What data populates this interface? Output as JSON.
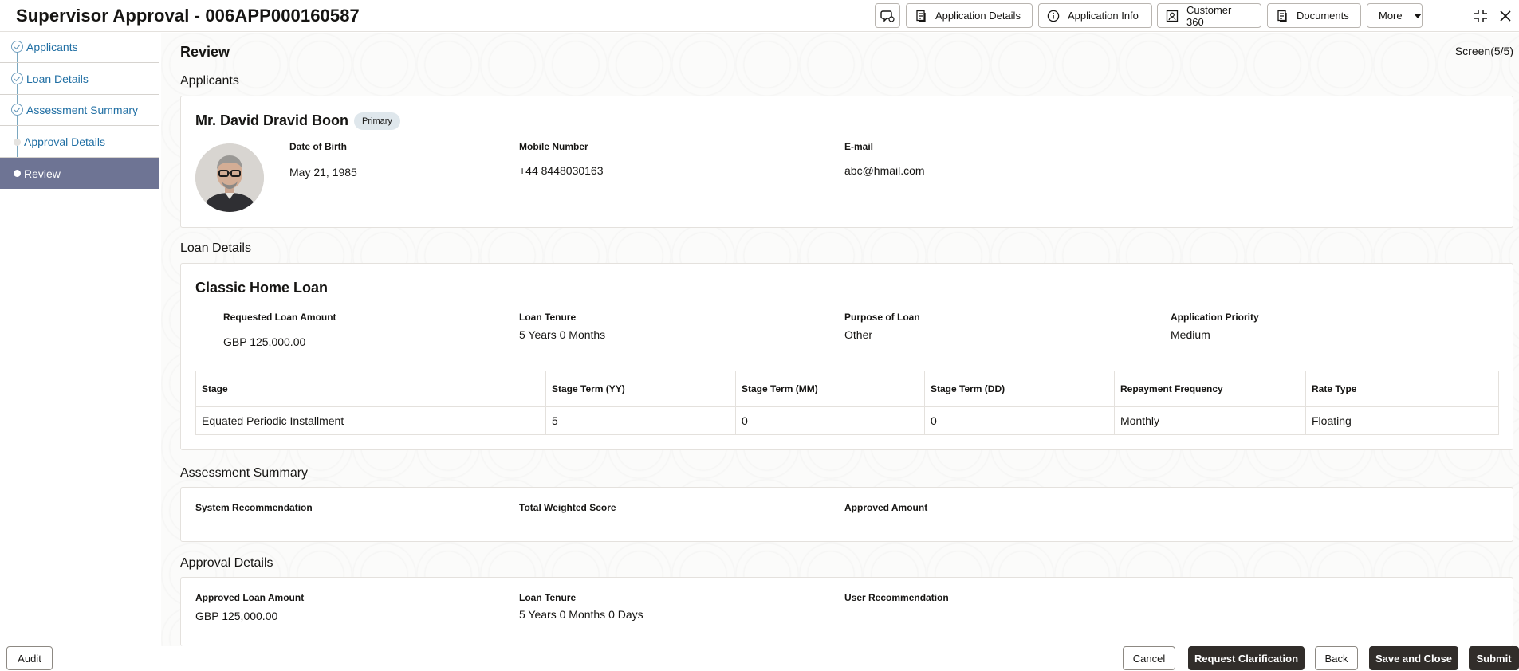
{
  "header": {
    "title": "Supervisor Approval - 006APP000160587",
    "chat_icon": "chat-bubble-icon",
    "buttons": {
      "application_details": "Application Details",
      "application_info": "Application Info",
      "customer_360": "Customer 360",
      "documents": "Documents",
      "more": "More"
    },
    "icons": {
      "document": "document-icon",
      "info": "info-icon",
      "person": "person-card-icon",
      "collapse": "collapse-icon",
      "close": "close-icon",
      "caret": "caret-down-icon"
    }
  },
  "sidebar": {
    "steps": [
      {
        "label": "Applicants",
        "state": "completed"
      },
      {
        "label": "Loan Details",
        "state": "completed"
      },
      {
        "label": "Assessment Summary",
        "state": "completed"
      },
      {
        "label": "Approval Details",
        "state": "pending"
      },
      {
        "label": "Review",
        "state": "active"
      }
    ]
  },
  "main": {
    "title": "Review",
    "screen": "Screen(5/5)",
    "applicants": {
      "section_title": "Applicants",
      "name": "Mr. David Dravid Boon",
      "badge": "Primary",
      "fields": {
        "dob_label": "Date of Birth",
        "dob_value": "May 21, 1985",
        "mobile_label": "Mobile Number",
        "mobile_value": "+44 8448030163",
        "email_label": "E-mail",
        "email_value": "abc@hmail.com"
      }
    },
    "loan": {
      "section_title": "Loan Details",
      "product": "Classic Home Loan",
      "fields": {
        "amount_label": "Requested Loan Amount",
        "amount_value": "GBP 125,000.00",
        "tenure_label": "Loan Tenure",
        "tenure_value": "5 Years 0 Months",
        "purpose_label": "Purpose of Loan",
        "purpose_value": "Other",
        "priority_label": "Application Priority",
        "priority_value": "Medium"
      },
      "table": {
        "headers": [
          "Stage",
          "Stage Term (YY)",
          "Stage Term (MM)",
          "Stage Term (DD)",
          "Repayment Frequency",
          "Rate Type"
        ],
        "rows": [
          [
            "Equated Periodic Installment",
            "5",
            "0",
            "0",
            "Monthly",
            "Floating"
          ]
        ]
      }
    },
    "assessment": {
      "section_title": "Assessment Summary",
      "fields": {
        "system_label": "System Recommendation",
        "score_label": "Total Weighted Score",
        "approved_label": "Approved Amount"
      }
    },
    "approval": {
      "section_title": "Approval Details",
      "fields": {
        "amount_label": "Approved Loan Amount",
        "amount_value": "GBP 125,000.00",
        "tenure_label": "Loan Tenure",
        "tenure_value": "5 Years 0 Months 0 Days",
        "recommendation_label": "User Recommendation"
      }
    }
  },
  "footer": {
    "audit": "Audit",
    "cancel": "Cancel",
    "request_clarification": "Request Clarification",
    "back": "Back",
    "save_close": "Save and Close",
    "submit": "Submit"
  },
  "colors": {
    "active_step": "#6e7494",
    "link": "#1f6ea3",
    "primary_button": "#312d2a"
  }
}
